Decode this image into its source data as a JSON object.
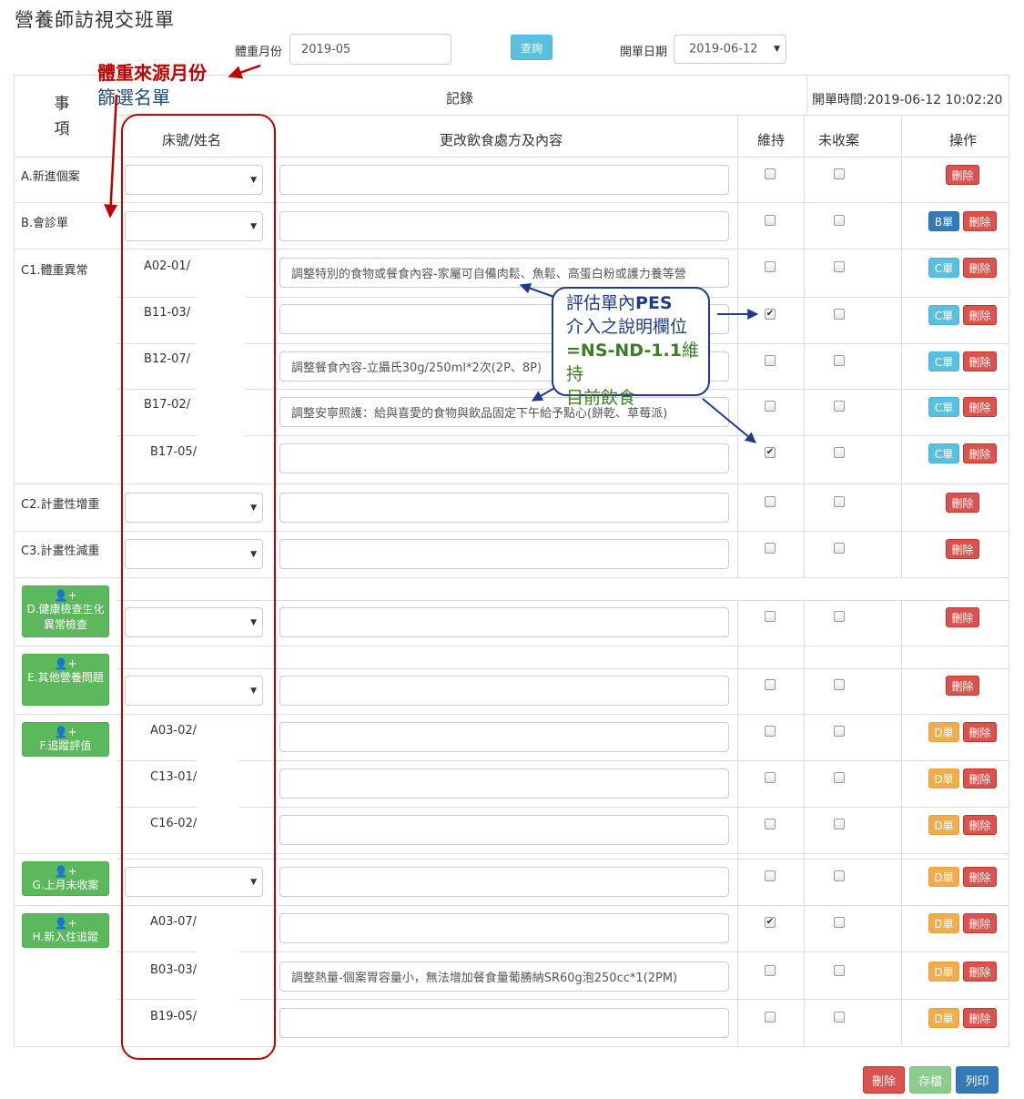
{
  "page": {
    "title": "營養師訪視交班單"
  },
  "filters": {
    "weight_month_label": "體重月份",
    "weight_month_value": "2019-05",
    "query_button": "查詢",
    "open_date_label": "開單日期",
    "open_date_value": "2019-06-12"
  },
  "table": {
    "header": {
      "item_col": "事\n項",
      "record": "記錄",
      "open_time": "開單時間:2019-06-12 10:02:20",
      "bed_name": "床號/姓名",
      "diet_change": "更改飲食處方及內容",
      "maintain": "維持",
      "not_closed": "未收案",
      "action": "操作"
    },
    "items": {
      "a": "A.新進個案",
      "b": "B.會診單",
      "c1": "C1.體重異常",
      "c2": "C2.計畫性增重",
      "c3": "C3.計畫性減重",
      "d": "D.健康檢查生化異常檢查",
      "e": "E.其他營養問題",
      "f": "F.追蹤評值",
      "g": "G.上月未收案",
      "h": "H.新入住追蹤"
    },
    "beds": {
      "c1_1": "A02-01/",
      "c1_2": "B11-03/",
      "c1_3": "B12-07/",
      "c1_4": "B17-02/",
      "c1_5": "B17-05/",
      "f_1": "A03-02/",
      "f_2": "C13-01/",
      "f_3": "C16-02/",
      "h_1": "A03-07/",
      "h_2": "B03-03/",
      "h_3": "B19-05/"
    },
    "contents": {
      "c1_1": "調整特別的食物或餐食內容-家屬可自備肉鬆、魚鬆、高蛋白粉或護力養等營",
      "c1_3": "調整餐食內容-立攝氏30g/250ml*2次(2P、8P)",
      "c1_4": "調整安寧照護：給與喜愛的食物與飲品固定下午給予點心(餅乾、草莓派)",
      "h_2": "調整熱量-個案胃容量小，無法增加餐食量葡勝納SR60g泡250cc*1(2PM)"
    },
    "checked": {
      "c1_2_maintain": true,
      "c1_5_maintain": true,
      "h_1_maintain": true
    }
  },
  "buttons": {
    "delete": "刪除",
    "b_form": "B單",
    "c_form": "C單",
    "d_form": "D單",
    "add_icon": "user-plus-icon"
  },
  "footer": {
    "delete": "刪除",
    "save": "存檔",
    "print": "列印"
  },
  "annotations": {
    "red_note": "體重來源月份",
    "blue_note": "篩選名單",
    "bubble_line1": "評估單內",
    "bubble_pes": "PES",
    "bubble_line2": "介入之說明欄位",
    "bubble_code": "=NS-ND-1.1",
    "bubble_line3": "維持",
    "bubble_line4": "目前飲食"
  },
  "colors": {
    "danger": "#d9534f",
    "primary": "#337ab7",
    "info": "#5bc0de",
    "warning": "#f0ad4e",
    "success": "#5cb85c",
    "annotation_red": "#c00000",
    "annotation_blue": "#1f3c88"
  }
}
